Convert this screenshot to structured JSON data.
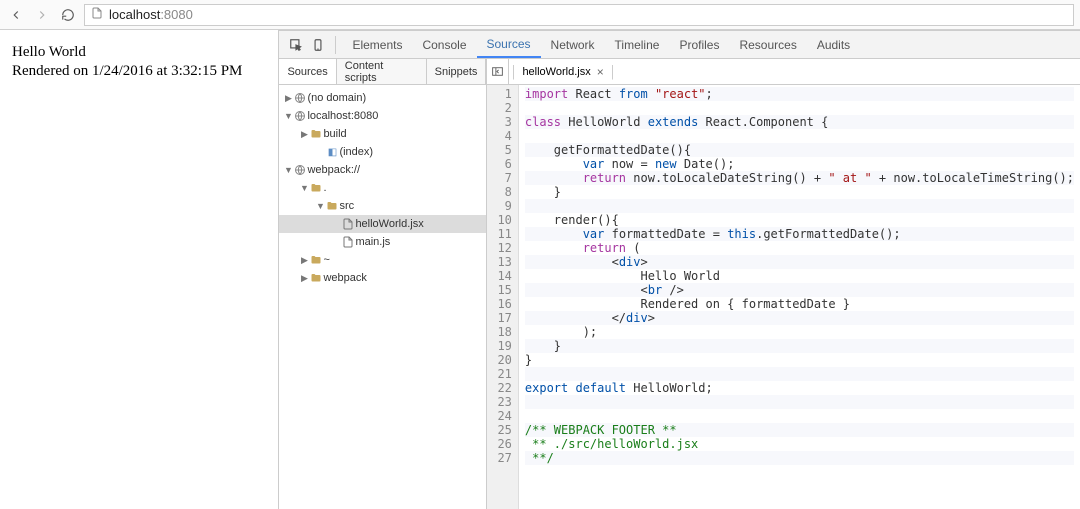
{
  "address": {
    "host": "localhost",
    "port": ":8080"
  },
  "page": {
    "line1": "Hello World",
    "line2": "Rendered on 1/24/2016 at 3:32:15 PM"
  },
  "dt_tabs": [
    "Elements",
    "Console",
    "Sources",
    "Network",
    "Timeline",
    "Profiles",
    "Resources",
    "Audits"
  ],
  "dt_tab_active": "Sources",
  "sub_tabs": [
    "Sources",
    "Content scripts",
    "Snippets"
  ],
  "sub_tab_active": "Sources",
  "open_file_tab": "helloWorld.jsx",
  "tree": {
    "no_domain": "(no domain)",
    "host": "localhost:8080",
    "build": "build",
    "index": "(index)",
    "webpack": "webpack://",
    "dot": ".",
    "src": "src",
    "hello": "helloWorld.jsx",
    "main": "main.js",
    "tilde": "~",
    "wp": "webpack"
  },
  "code_lines": [
    [
      [
        "k",
        "import"
      ],
      [
        "p",
        " React "
      ],
      [
        "k2",
        "from "
      ],
      [
        "s",
        "\"react\""
      ],
      [
        "p",
        ";"
      ]
    ],
    [],
    [
      [
        "k",
        "class"
      ],
      [
        "p",
        " HelloWorld "
      ],
      [
        "k2",
        "extends"
      ],
      [
        "p",
        " React.Component {"
      ]
    ],
    [],
    [
      [
        "p",
        "    getFormattedDate(){"
      ]
    ],
    [
      [
        "p",
        "        "
      ],
      [
        "k2",
        "var"
      ],
      [
        "p",
        " now = "
      ],
      [
        "k2",
        "new"
      ],
      [
        "p",
        " Date();"
      ]
    ],
    [
      [
        "p",
        "        "
      ],
      [
        "k",
        "return"
      ],
      [
        "p",
        " now.toLocaleDateString() + "
      ],
      [
        "s",
        "\" at \""
      ],
      [
        "p",
        " + now.toLocaleTimeString();"
      ]
    ],
    [
      [
        "p",
        "    }"
      ]
    ],
    [],
    [
      [
        "p",
        "    render(){"
      ]
    ],
    [
      [
        "p",
        "        "
      ],
      [
        "k2",
        "var"
      ],
      [
        "p",
        " formattedDate = "
      ],
      [
        "k2",
        "this"
      ],
      [
        "p",
        ".getFormattedDate();"
      ]
    ],
    [
      [
        "p",
        "        "
      ],
      [
        "k",
        "return"
      ],
      [
        "p",
        " ("
      ]
    ],
    [
      [
        "p",
        "            <"
      ],
      [
        "t",
        "div"
      ],
      [
        "p",
        ">"
      ]
    ],
    [
      [
        "p",
        "                Hello World"
      ]
    ],
    [
      [
        "p",
        "                <"
      ],
      [
        "t",
        "br"
      ],
      [
        "p",
        " />"
      ]
    ],
    [
      [
        "p",
        "                Rendered on { formattedDate }"
      ]
    ],
    [
      [
        "p",
        "            </"
      ],
      [
        "t",
        "div"
      ],
      [
        "p",
        ">"
      ]
    ],
    [
      [
        "p",
        "        );"
      ]
    ],
    [
      [
        "p",
        "    }"
      ]
    ],
    [
      [
        "p",
        "}"
      ]
    ],
    [],
    [
      [
        "k2",
        "export default"
      ],
      [
        "p",
        " HelloWorld;"
      ]
    ],
    [],
    [],
    [
      [
        "c",
        "/** WEBPACK FOOTER **"
      ]
    ],
    [
      [
        "c",
        " ** ./src/helloWorld.jsx"
      ]
    ],
    [
      [
        "c",
        " **/"
      ]
    ]
  ]
}
